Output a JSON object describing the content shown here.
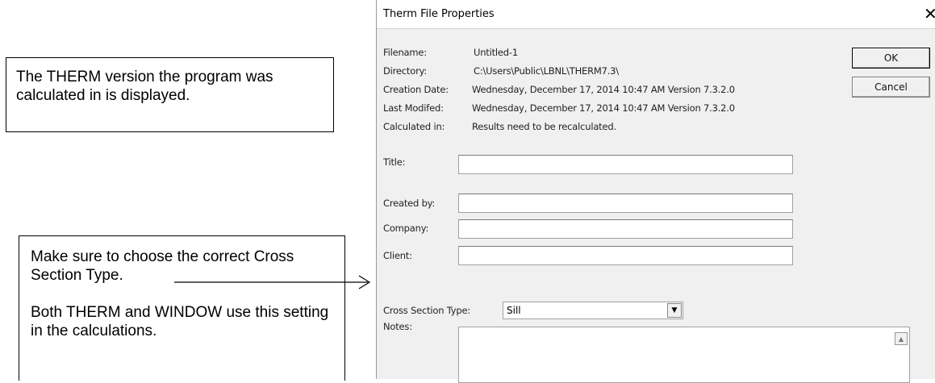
{
  "callouts": {
    "version": "The THERM version the program was calculated in is displayed.",
    "cross_section_line1": "Make sure to choose the correct Cross Section Type.",
    "cross_section_line2": "Both THERM and WINDOW use this setting in the calculations."
  },
  "dialog": {
    "title": "Therm File Properties",
    "close_glyph": "✕",
    "ok_label": "OK",
    "cancel_label": "Cancel",
    "info": {
      "filename_label": "Filename:",
      "filename_value": "Untitled-1",
      "directory_label": "Directory:",
      "directory_value": "C:\\Users\\Public\\LBNL\\THERM7.3\\",
      "creation_label": "Creation Date:",
      "creation_value": "Wednesday, December 17, 2014 10:47 AM Version 7.3.2.0",
      "modified_label": "Last Modifed:",
      "modified_value": "Wednesday, December 17, 2014 10:47 AM Version 7.3.2.0",
      "calculated_label": "Calculated in:",
      "calculated_value": "Results need to be recalculated."
    },
    "fields": {
      "title_label": "Title:",
      "title_value": "",
      "created_by_label": "Created by:",
      "created_by_value": "",
      "company_label": "Company:",
      "company_value": "",
      "client_label": "Client:",
      "client_value": ""
    },
    "cross_section_label": "Cross Section Type:",
    "cross_section_value": "Sill",
    "notes_label": "Notes:",
    "notes_value": ""
  }
}
